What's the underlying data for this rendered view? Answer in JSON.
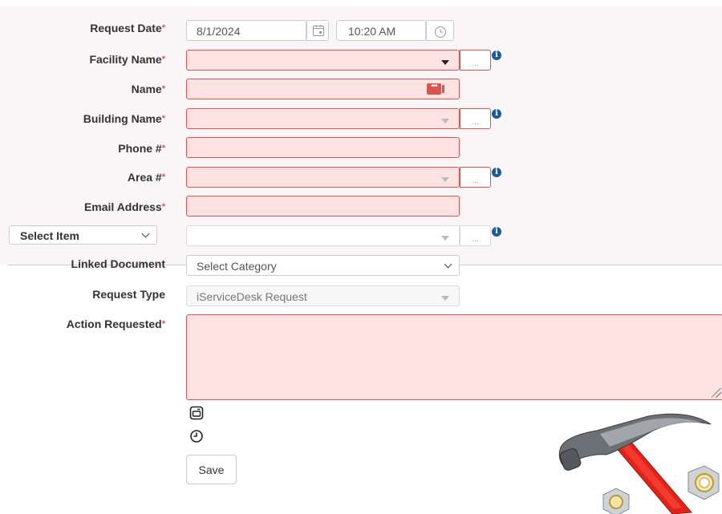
{
  "form": {
    "request_date": {
      "label": "Request Date",
      "date_value": "8/1/2024",
      "time_value": "10:20 AM"
    },
    "facility_name": {
      "label": "Facility Name",
      "value": ""
    },
    "name": {
      "label": "Name",
      "value": ""
    },
    "building_name": {
      "label": "Building Name",
      "value": ""
    },
    "phone": {
      "label": "Phone #",
      "value": ""
    },
    "area": {
      "label": "Area #",
      "value": ""
    },
    "email": {
      "label": "Email Address",
      "value": ""
    },
    "select_item": {
      "value": "Select Item",
      "field_value": ""
    },
    "linked_document": {
      "label": "Linked Document",
      "value": "Select Category"
    },
    "request_type": {
      "label": "Request Type",
      "value": "iServiceDesk Request"
    },
    "action_requested": {
      "label": "Action Requested",
      "value": ""
    },
    "required_marker": "*",
    "save_label": "Save"
  },
  "icons": {
    "calendar": "calendar-icon",
    "clock": "clock-icon",
    "info": "info-icon",
    "ellipsis": "ellipsis-icon",
    "edit": "edit-icon",
    "history": "history-icon",
    "hammer": "hammer-illustration"
  },
  "colors": {
    "error_background": "#ffe2e2",
    "error_border": "#d9534f",
    "info_blue": "#1c5a9c",
    "required_red": "#d9534f"
  }
}
